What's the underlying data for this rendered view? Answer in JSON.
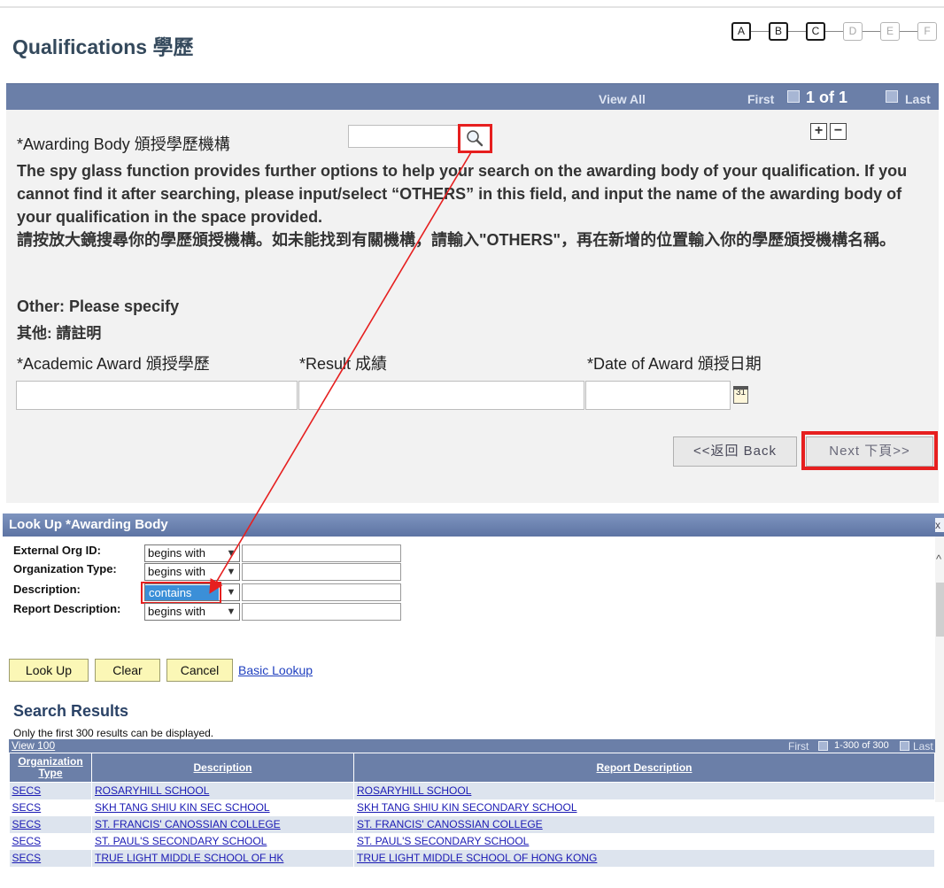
{
  "header": {
    "title": "Qualifications 學歷",
    "steps": [
      {
        "label": "A",
        "active": true
      },
      {
        "label": "B",
        "active": true
      },
      {
        "label": "C",
        "active": true
      },
      {
        "label": "D",
        "active": false
      },
      {
        "label": "E",
        "active": false
      },
      {
        "label": "F",
        "active": false
      }
    ]
  },
  "grid_nav": {
    "view_all": "View All",
    "first": "First",
    "row_count": "1 of 1",
    "last": "Last"
  },
  "form": {
    "awarding_body_label": "*Awarding Body 頒授學歷機構",
    "awarding_body_value": "",
    "lookup_icon": "magnifier-icon",
    "help_text_en": "The spy glass function provides further options to help your search on the awarding body of your qualification. If you cannot find it after searching, please input/select “OTHERS” in this field, and input the name of the awarding body of your qualification in the space provided.",
    "help_text_zh": "請按放大鏡搜尋你的學歷頒授機構。如未能找到有關機構，請輸入\"OTHERS\"，再在新增的位置輸入你的學歷頒授機構名稱。",
    "other_en": "Other: Please specify",
    "other_zh": "其他: 請註明",
    "academic_label": "*Academic Award 頒授學歷",
    "result_label": "*Result 成績",
    "date_label": "*Date of Award 頒授日期",
    "calendar_text": "31",
    "plus": "+",
    "minus": "−",
    "back_button": "<<返回 Back",
    "next_button": "Next 下頁>>"
  },
  "lookup_dialog": {
    "title": "Look Up *Awarding Body",
    "close": "x",
    "fields": [
      {
        "label": "External Org ID:",
        "operator": "begins with"
      },
      {
        "label": "Organization Type:",
        "operator": "begins with"
      },
      {
        "label": "Description:",
        "operator": "contains"
      },
      {
        "label": "Report Description:",
        "operator": "begins with"
      }
    ],
    "buttons": {
      "look_up": "Look Up",
      "clear": "Clear",
      "cancel": "Cancel",
      "basic_lookup": "Basic Lookup"
    },
    "search_results_title": "Search Results",
    "results_note": "Only the first 300 results can be displayed.",
    "view100": "View 100",
    "nav": {
      "first": "First",
      "count": "1-300 of 300",
      "last": "Last"
    },
    "columns": [
      "Organization Type",
      "Description",
      "Report Description"
    ],
    "rows": [
      [
        "SECS",
        "ROSARYHILL SCHOOL",
        "ROSARYHILL SCHOOL"
      ],
      [
        "SECS",
        "SKH TANG SHIU KIN SEC SCHOOL",
        "SKH TANG SHIU KIN SECONDARY SCHOOL"
      ],
      [
        "SECS",
        "ST. FRANCIS' CANOSSIAN COLLEGE",
        "ST. FRANCIS' CANOSSIAN COLLEGE"
      ],
      [
        "SECS",
        "ST. PAUL'S SECONDARY SCHOOL",
        "ST. PAUL'S SECONDARY SCHOOL"
      ],
      [
        "SECS",
        "TRUE LIGHT MIDDLE SCHOOL OF HK",
        "TRUE LIGHT MIDDLE SCHOOL OF HONG KONG"
      ]
    ]
  },
  "colors": {
    "header_bar": "#6b7fa8",
    "highlight_red": "#e61f1f",
    "link_blue": "#1a1ab4",
    "title_blue": "#34495c"
  }
}
